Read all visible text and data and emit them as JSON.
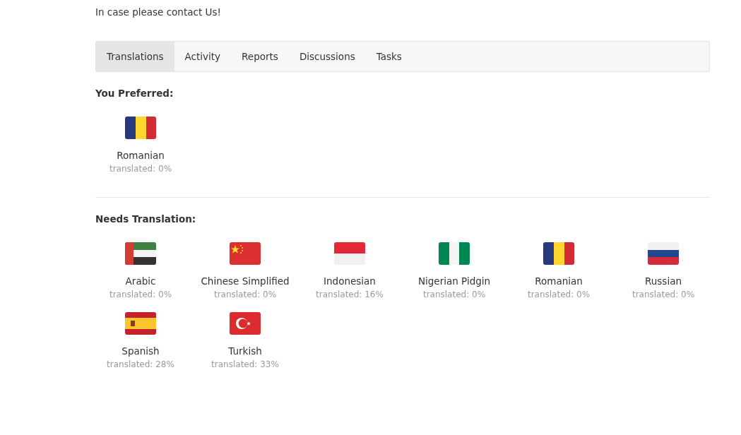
{
  "intro": "In case please contact Us!",
  "tabs": [
    {
      "label": "Translations",
      "selected": true
    },
    {
      "label": "Activity",
      "selected": false
    },
    {
      "label": "Reports",
      "selected": false
    },
    {
      "label": "Discussions",
      "selected": false
    },
    {
      "label": "Tasks",
      "selected": false
    }
  ],
  "sections": [
    {
      "title": "You Preferred:",
      "languages": [
        {
          "kind": "ro",
          "name": "Romanian",
          "status": "translated: 0%"
        }
      ]
    },
    {
      "title": "Needs Translation:",
      "languages": [
        {
          "kind": "ae",
          "name": "Arabic",
          "status": "translated: 0%"
        },
        {
          "kind": "cn",
          "name": "Chinese Simplified",
          "status": "translated: 0%"
        },
        {
          "kind": "id",
          "name": "Indonesian",
          "status": "translated: 16%"
        },
        {
          "kind": "ng",
          "name": "Nigerian Pidgin",
          "status": "translated: 0%"
        },
        {
          "kind": "ro",
          "name": "Romanian",
          "status": "translated: 0%"
        },
        {
          "kind": "ru",
          "name": "Russian",
          "status": "translated: 0%"
        },
        {
          "kind": "es",
          "name": "Spanish",
          "status": "translated: 28%"
        },
        {
          "kind": "tr",
          "name": "Turkish",
          "status": "translated: 33%"
        }
      ]
    }
  ]
}
